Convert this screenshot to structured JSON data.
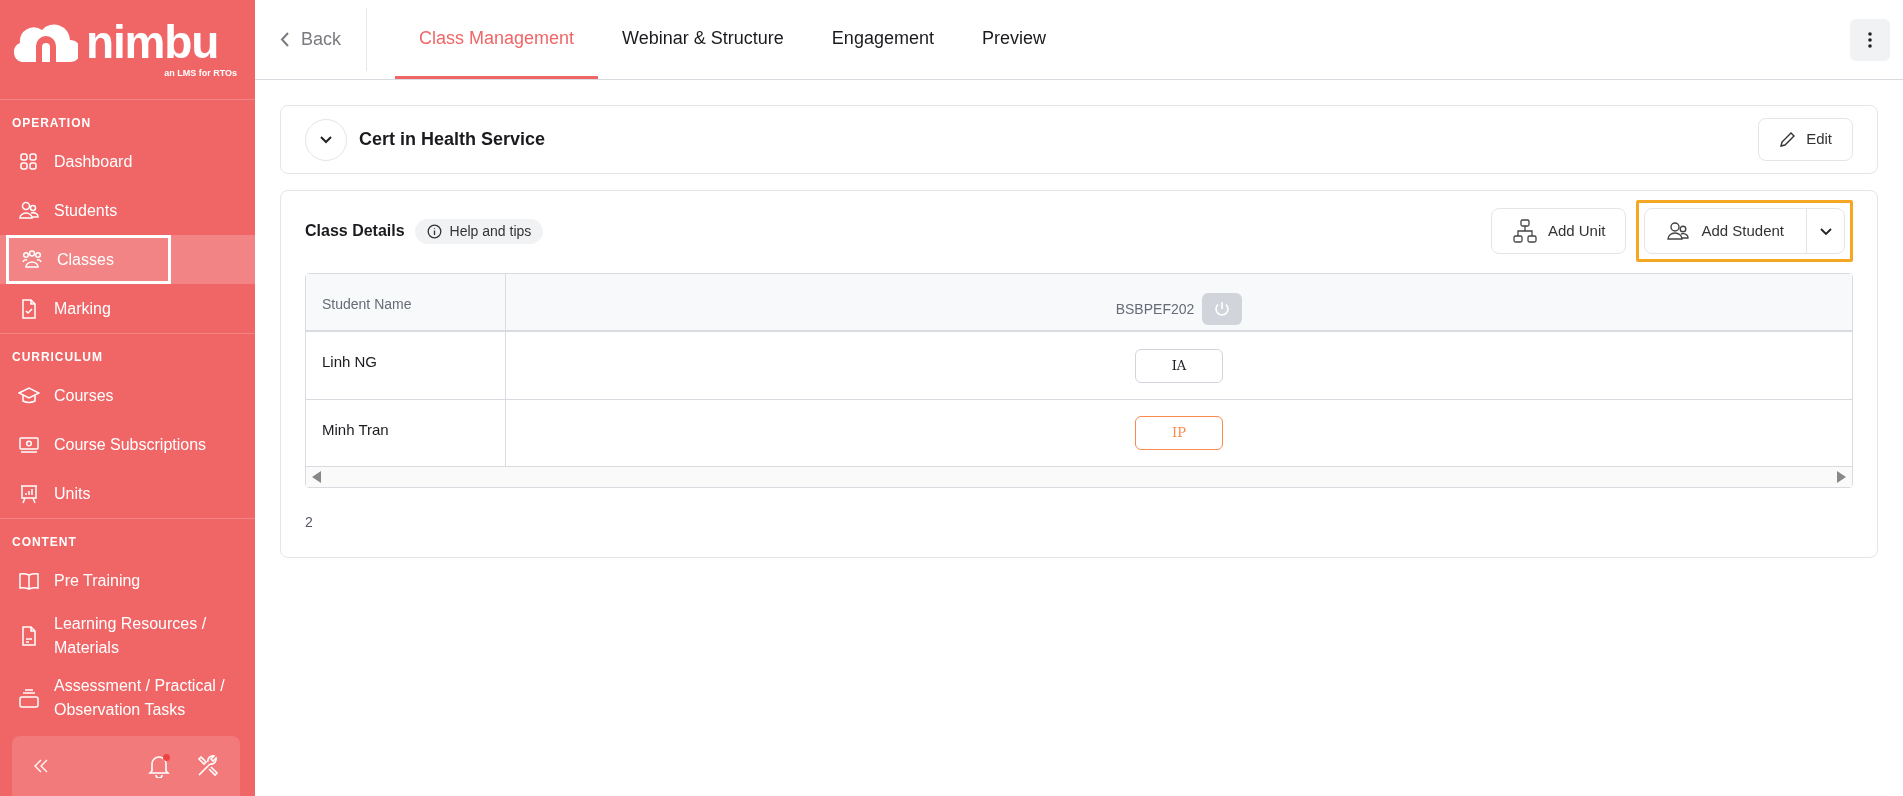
{
  "logo": {
    "wordmark": "nimbu",
    "tagline": "an LMS for RTOs"
  },
  "sidebar": {
    "sections": [
      {
        "title": "OPERATION",
        "items": [
          {
            "label": "Dashboard",
            "selected": false
          },
          {
            "label": "Students",
            "selected": false
          },
          {
            "label": "Classes",
            "selected": true
          },
          {
            "label": "Marking",
            "selected": false
          }
        ]
      },
      {
        "title": "CURRICULUM",
        "items": [
          {
            "label": "Courses",
            "selected": false
          },
          {
            "label": "Course Subscriptions",
            "selected": false
          },
          {
            "label": "Units",
            "selected": false
          }
        ]
      },
      {
        "title": "CONTENT",
        "items": [
          {
            "label": "Pre Training",
            "selected": false
          },
          {
            "label": "Learning Resources / Materials",
            "selected": false
          },
          {
            "label": "Assessment / Practical / Observation Tasks",
            "selected": false
          }
        ]
      }
    ],
    "footer": {
      "notification_unread": true
    }
  },
  "top_bar": {
    "back": "Back",
    "tabs": [
      {
        "label": "Class Management",
        "selected": true
      },
      {
        "label": "Webinar & Structure",
        "selected": false
      },
      {
        "label": "Engagement",
        "selected": false
      },
      {
        "label": "Preview",
        "selected": false
      }
    ]
  },
  "class_card": {
    "title": "Cert in Health Service",
    "edit_button": "Edit"
  },
  "details": {
    "title": "Class Details",
    "help": "Help and tips",
    "buttons": [
      {
        "label": "Add Unit",
        "kind": "plain",
        "highlighted": false
      },
      {
        "label": "Add Student",
        "kind": "split",
        "highlighted": true
      }
    ],
    "table": {
      "columns": [
        "Student Name",
        "BSBPEF202"
      ],
      "rows": [
        {
          "name": "Linh NG",
          "status": "IA",
          "color": "#d1d5db"
        },
        {
          "name": "Minh Tran",
          "status": "IP",
          "color": "#fb8a4c"
        }
      ]
    },
    "count": "2"
  }
}
